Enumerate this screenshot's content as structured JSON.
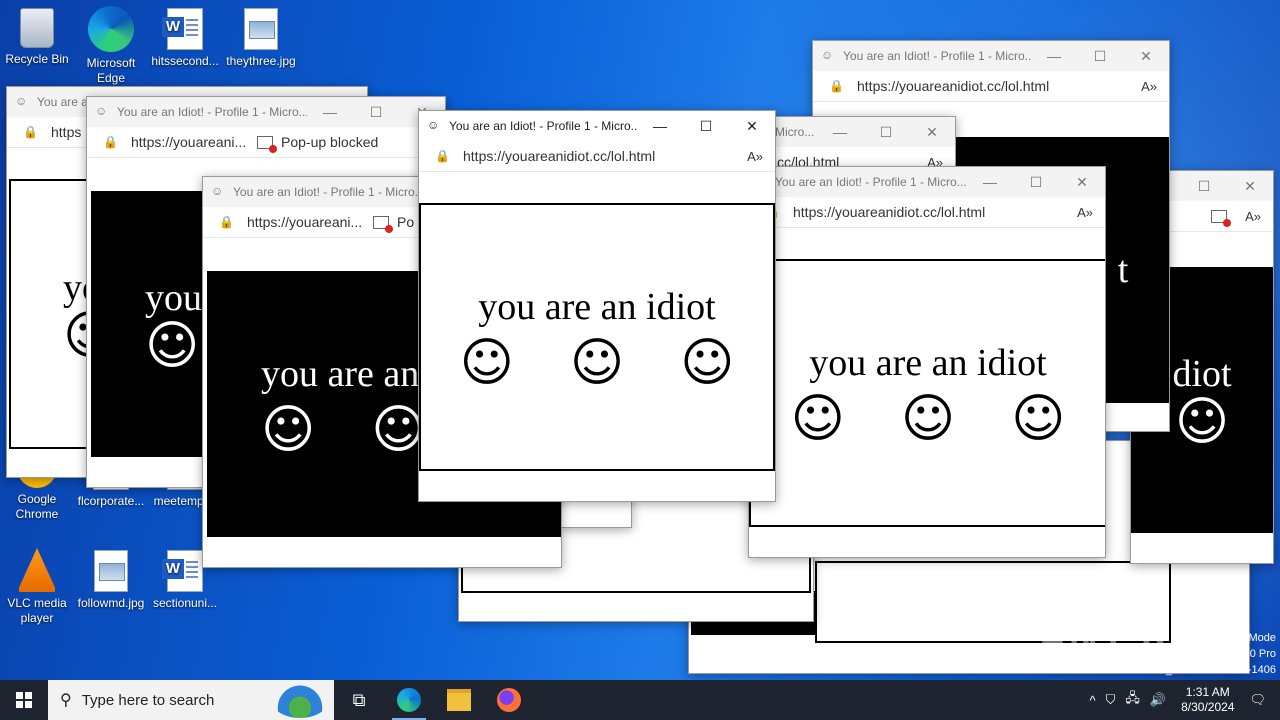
{
  "desktop": {
    "icons": [
      {
        "label": "Recycle Bin"
      },
      {
        "label": "Microsoft Edge"
      },
      {
        "label": "hitssecond..."
      },
      {
        "label": "theythree.jpg"
      },
      {
        "label": "Google Chrome"
      },
      {
        "label": "flcorporate..."
      },
      {
        "label": "meetempl..."
      },
      {
        "label": "VLC media player"
      },
      {
        "label": "followmd.jpg"
      },
      {
        "label": "sectionuni..."
      }
    ]
  },
  "popup": {
    "title": "You are an Idiot! - Profile 1 - Micro...",
    "title_short": "You are an",
    "url": "https://youareanidiot.cc/lol.html",
    "url_short": "https://youareani...",
    "url_tiny": "https",
    "url_fragment": "cc/lol.html",
    "title_fragment": "Micro...",
    "phrase": "you are an idiot",
    "phrase_cut1": "you are an",
    "phrase_cut2": "you",
    "phrase_cut3": "yo",
    "phrase_cut4": "t",
    "phrase_cut5": "diot",
    "face": "☺",
    "blocked": "Pop-up blocked",
    "blocked_short": "Po"
  },
  "watermark": {
    "line1": "Mode",
    "line2": "0 Pro",
    "line3": "Build 19041.vb_release.191206-1406",
    "brand": "ANY RUN"
  },
  "taskbar": {
    "search_placeholder": "Type here to search",
    "time": "1:31 AM",
    "date": "8/30/2024"
  },
  "colors": {
    "taskbar": "#1e2430",
    "wallpaper": "#0a5fd6"
  }
}
